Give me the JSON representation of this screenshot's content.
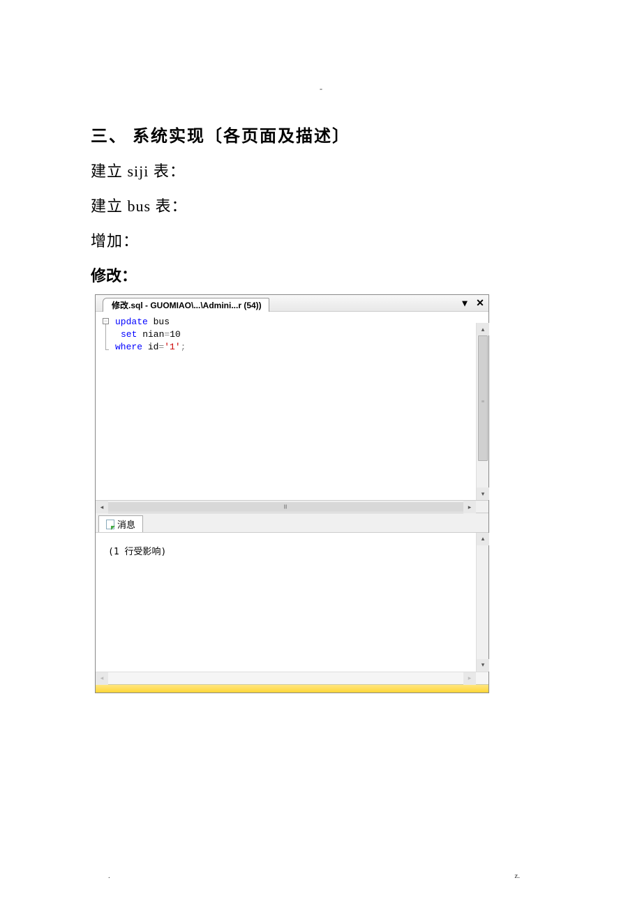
{
  "section_title": "三、 系统实现〔各页面及描述〕",
  "lines": {
    "siji": "建立 siji 表：",
    "bus": "建立 bus 表：",
    "add": "增加：",
    "modify": "修改："
  },
  "sql_window": {
    "tab_title": "修改.sql - GUOMIAO\\...\\Admini...r (54))",
    "code": {
      "line1_kw": "update",
      "line1_tbl": " bus",
      "line2_kw": "set",
      "line2_rest": " nian",
      "line2_op": "=",
      "line2_val": "10",
      "line3_kw": "where",
      "line3_rest": " id",
      "line3_op": "=",
      "line3_val": "'1'",
      "line3_end": ";"
    },
    "messages_tab": "消息",
    "message_text": "(1 行受影响)"
  },
  "footer": {
    "left": ".",
    "right": "z."
  },
  "header_mark": "-"
}
